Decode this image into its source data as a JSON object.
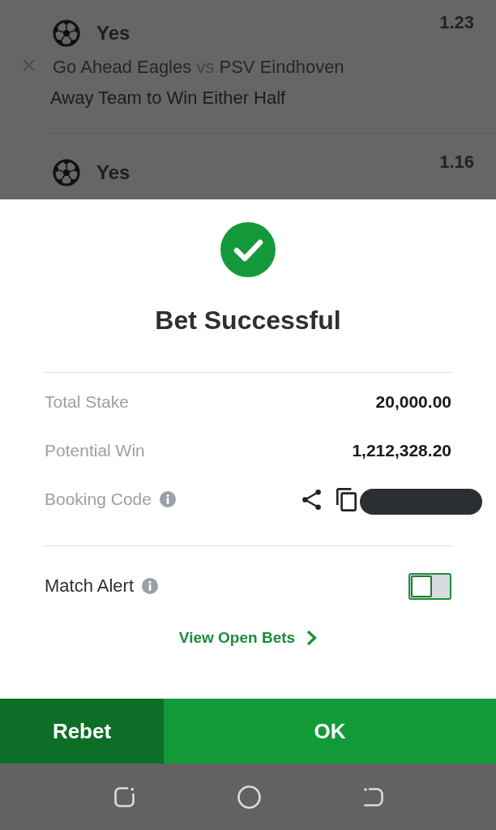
{
  "background_bets": [
    {
      "selection": "Yes",
      "odds": "1.23",
      "match": {
        "home": "Go Ahead Eagles",
        "separator": "vs",
        "away": "PSV Eindhoven"
      },
      "market": "Away Team to Win Either Half"
    },
    {
      "selection": "Yes",
      "odds": "1.16"
    }
  ],
  "dialog": {
    "title": "Bet Successful",
    "summary": [
      {
        "kind": "amount",
        "label": "Total Stake",
        "value": "20,000.00"
      },
      {
        "kind": "amount",
        "label": "Potential Win",
        "value": "1,212,328.20"
      },
      {
        "kind": "code",
        "label": "Booking Code"
      }
    ],
    "match_alert": {
      "label": "Match Alert",
      "on": false
    },
    "link": "View Open Bets"
  },
  "buttons": [
    {
      "label": "Rebet",
      "kind": "secondary"
    },
    {
      "label": "OK",
      "kind": "primary"
    }
  ]
}
